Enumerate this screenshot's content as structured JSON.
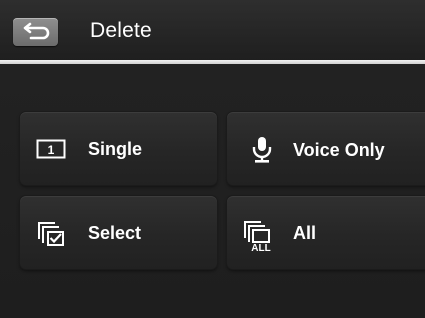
{
  "header": {
    "title": "Delete",
    "back_icon": "back-arrow-icon"
  },
  "options": {
    "single": {
      "label": "Single",
      "icon": "single-frame-icon",
      "icon_text": "1"
    },
    "voice_only": {
      "label": "Voice Only",
      "icon": "microphone-icon"
    },
    "select": {
      "label": "Select",
      "icon": "select-check-icon"
    },
    "all": {
      "label": "All",
      "icon": "all-frames-icon",
      "icon_text": "ALL"
    }
  },
  "colors": {
    "background": "#262626",
    "divider": "#f4f4f4",
    "text": "#ffffff",
    "back_button": "#8f8f8f"
  }
}
